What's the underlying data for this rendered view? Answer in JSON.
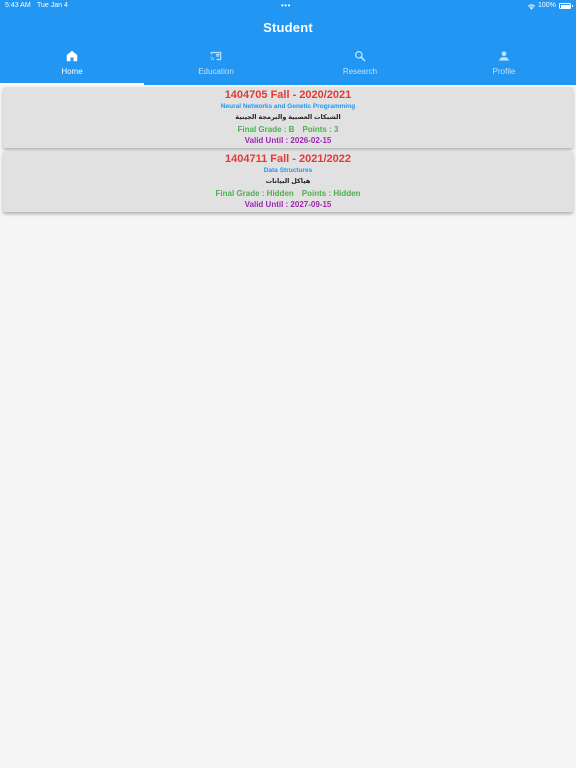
{
  "status_bar": {
    "time": "5:43 AM",
    "date": "Tue Jan 4",
    "dots": "•••",
    "battery": "100%"
  },
  "app_bar": {
    "title": "Student",
    "color": "#2196f3"
  },
  "tabs": [
    {
      "label": "Home",
      "icon": "home-icon",
      "active": true
    },
    {
      "label": "Education",
      "icon": "cast-for-education-icon",
      "active": false
    },
    {
      "label": "Research",
      "icon": "search-icon",
      "active": false
    },
    {
      "label": "Profile",
      "icon": "person-icon",
      "active": false
    }
  ],
  "courses": [
    {
      "title": "1404705 Fall - 2020/2021",
      "name_en": "Neural Networks and Genetic Programming",
      "name_ar": "الشبكات العصبية والبرمجة الجينية",
      "final_grade": "Final Grade : B",
      "points": "Points : 3",
      "valid_until": "Valid Until : 2026-02-15"
    },
    {
      "title": "1404711 Fall - 2021/2022",
      "name_en": "Data Structures",
      "name_ar": "هياكل البيانات",
      "final_grade": "Final Grade : Hidden",
      "points": "Points : Hidden",
      "valid_until": "Valid Until : 2027-09-15"
    }
  ],
  "colors": {
    "title_red": "#e53935",
    "course_blue": "#2196f3",
    "grade_green": "#4caf50",
    "valid_purple": "#9c27b0",
    "card_bg": "#e1e1e1"
  }
}
